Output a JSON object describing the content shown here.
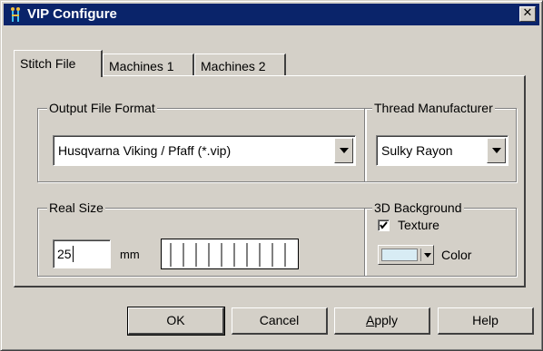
{
  "window": {
    "title": "VIP Configure",
    "close_glyph": "✕"
  },
  "tabs": [
    {
      "label": "Stitch File",
      "active": true
    },
    {
      "label": "Machines 1",
      "active": false
    },
    {
      "label": "Machines 2",
      "active": false
    }
  ],
  "output_format": {
    "legend": "Output File Format",
    "selected": "Husqvarna Viking / Pfaff (*.vip)"
  },
  "thread": {
    "legend": "Thread Manufacturer",
    "selected": "Sulky Rayon"
  },
  "real_size": {
    "legend": "Real Size",
    "value": "25",
    "unit": "mm",
    "ruler_ticks": 10
  },
  "background": {
    "legend": "3D Background",
    "texture_label": "Texture",
    "texture_checked": true,
    "color_label": "Color",
    "color_swatch": "#d8ecf4"
  },
  "buttons": {
    "ok": "OK",
    "cancel": "Cancel",
    "apply_first": "A",
    "apply_rest": "pply",
    "help": "Help"
  },
  "colors": {
    "face": "#d4d0c8",
    "titlebar": "#0a246a"
  },
  "icons": {
    "app": "vip-app-icon",
    "close": "close-icon",
    "dropdown": "chevron-down-icon",
    "check": "checkmark-icon"
  }
}
